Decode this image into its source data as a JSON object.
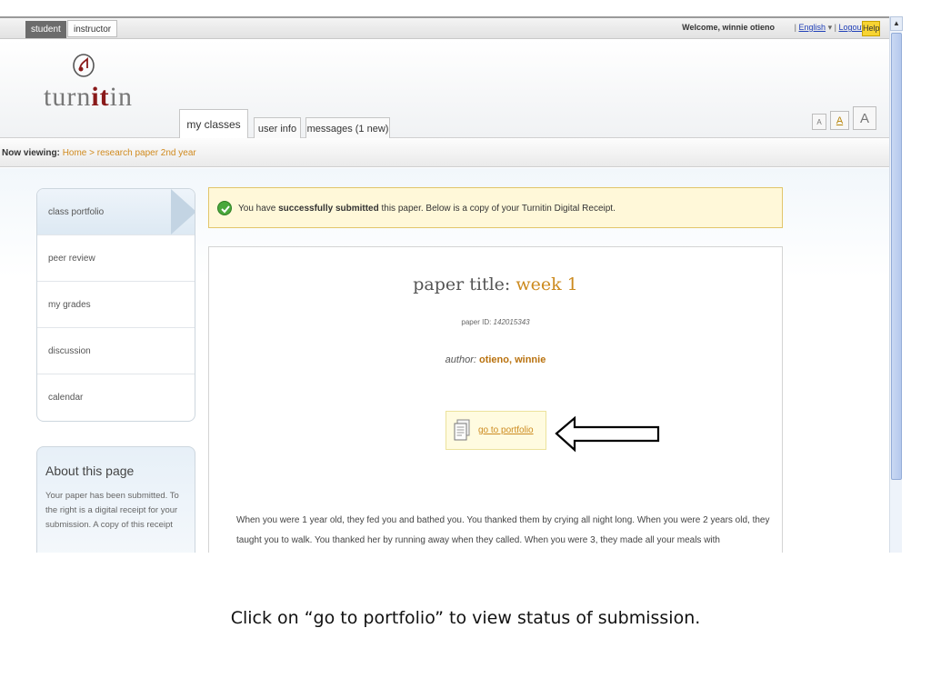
{
  "topbar": {
    "roles": [
      "student",
      "instructor"
    ],
    "welcome": "Welcome, winnie otieno",
    "language": "English",
    "logout": "Logout",
    "help": "Help"
  },
  "header": {
    "logo_text_pre": "turn",
    "logo_text_mid": "it",
    "logo_text_post": "in",
    "tabs": [
      "my classes",
      "user info",
      "messages (1 new)"
    ],
    "text_sizes": [
      "A",
      "A",
      "A"
    ]
  },
  "breadcrumb": {
    "label": "Now viewing:",
    "path": "Home > research paper 2nd year"
  },
  "sidebar": {
    "items": [
      "class portfolio",
      "peer review",
      "my grades",
      "discussion",
      "calendar"
    ]
  },
  "about": {
    "title": "About this page",
    "text": "Your paper has been submitted. To the right is a digital receipt for your submission. A copy of this receipt"
  },
  "success": {
    "pre": "You have ",
    "bold": "successfully submitted",
    "post": " this paper. Below is a copy of your Turnitin Digital Receipt."
  },
  "receipt": {
    "title_label": "paper title: ",
    "title_value": "week 1",
    "id_label": "paper ID: ",
    "id_value": "142015343",
    "author_label": "author: ",
    "author_value": "otieno, winnie",
    "portfolio_link": "go to portfolio",
    "body": "When you were 1 year old, they fed you and bathed you. You thanked them by crying all night long. When you were 2 years old, they taught you to walk. You thanked her by running away when they called. When you were 3, they made all your meals with"
  },
  "caption": "Click on “go to portfolio” to view status of submission.",
  "colors": {
    "accent": "#cc8a1e",
    "success_green": "#4aa83c",
    "link_blue": "#1f3fb8"
  }
}
